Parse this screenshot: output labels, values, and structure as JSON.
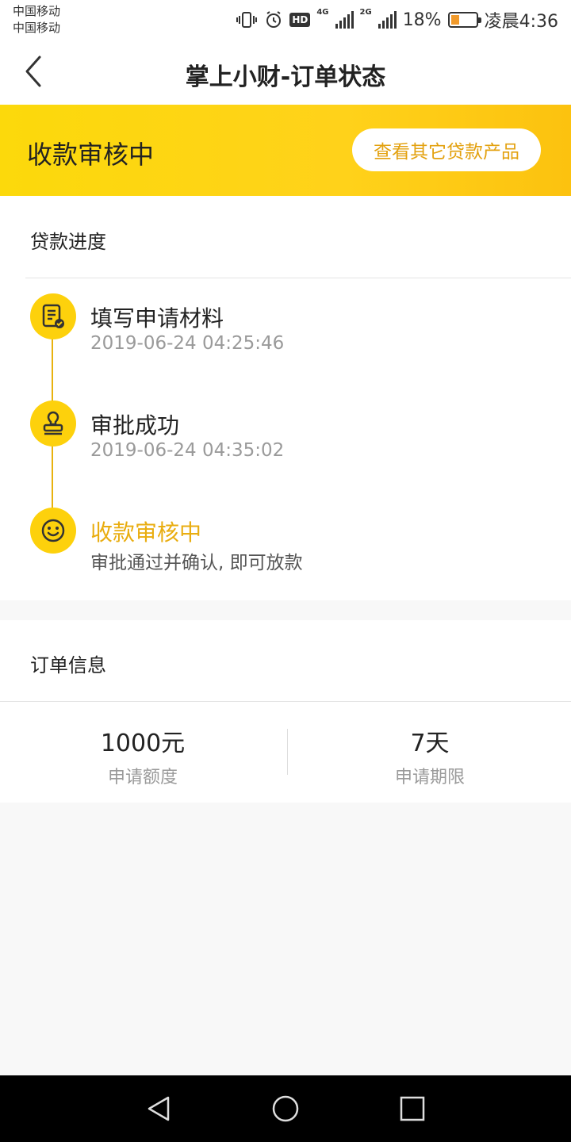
{
  "status_bar": {
    "carrier_1": "中国移动",
    "carrier_2": "中国移动",
    "network_1": "4G",
    "network_2": "2G",
    "hd_badge": "HD",
    "battery_percent": "18%",
    "time": "凌晨4:36",
    "icons": [
      "vibrate-icon",
      "alarm-icon",
      "hd-icon",
      "signal-icon",
      "battery-icon"
    ]
  },
  "nav": {
    "back_icon": "chevron-left-icon",
    "title": "掌上小财-订单状态"
  },
  "banner": {
    "status": "收款审核中",
    "other_products_button": "查看其它贷款产品",
    "accent_color": "#fdd10c"
  },
  "progress": {
    "section_title": "贷款进度",
    "steps": [
      {
        "icon": "document-check-icon",
        "title": "填写申请材料",
        "subtitle": "2019-06-24 04:25:46"
      },
      {
        "icon": "stamp-icon",
        "title": "审批成功",
        "subtitle": "2019-06-24 04:35:02"
      },
      {
        "icon": "smile-icon",
        "title": "收款审核中",
        "subtitle": "审批通过并确认, 即可放款"
      }
    ]
  },
  "order_info": {
    "section_title": "订单信息",
    "amount_value": "1000元",
    "amount_label": "申请额度",
    "term_value": "7天",
    "term_label": "申请期限"
  },
  "system_nav": {
    "icons": [
      "back-triangle-icon",
      "home-circle-icon",
      "recents-square-icon"
    ]
  }
}
